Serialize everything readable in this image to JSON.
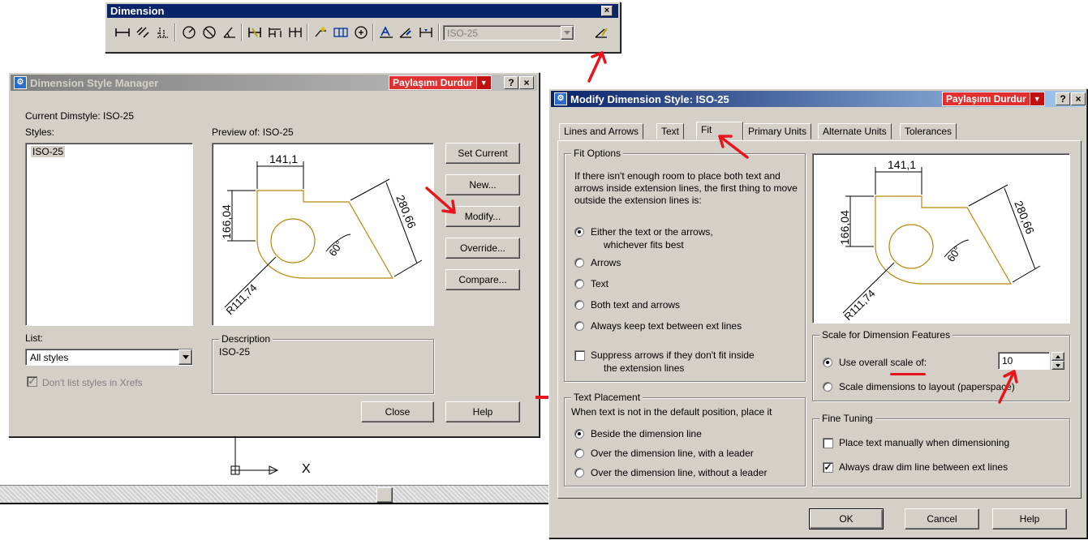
{
  "toolbar": {
    "title": "Dimension",
    "close": "×",
    "style_value": "ISO-25",
    "icons": [
      "linear-dim",
      "aligned-dim",
      "ordinate-dim",
      "radius-dim",
      "diameter-dim",
      "angular-dim",
      "quick-dim",
      "baseline-dim",
      "continue-dim",
      "leader",
      "tolerance",
      "center-mark",
      "dimedit",
      "dimtedit",
      "dim-update",
      "dim-style"
    ]
  },
  "dsm": {
    "title": "Dimension Style Manager",
    "share_label": "Paylaşımı Durdur",
    "help_cap": "?",
    "close_cap": "×",
    "current_dimstyle": "Current Dimstyle: ISO-25",
    "styles_label": "Styles:",
    "styles": [
      "ISO-25"
    ],
    "preview_label": "Preview of: ISO-25",
    "buttons": {
      "set_current": "Set Current",
      "new": "New...",
      "modify": "Modify...",
      "override": "Override...",
      "compare": "Compare...",
      "close": "Close",
      "help": "Help"
    },
    "list_label": "List:",
    "list_value": "All styles",
    "xrefs_label": "Don't list styles in Xrefs",
    "xrefs_mark": "✓",
    "description_label": "Description",
    "description_value": "ISO-25"
  },
  "preview": {
    "dim_top": "141,1",
    "dim_left": "166,04",
    "dim_diag": "280,66",
    "angle": "60°",
    "radius": "R111,74"
  },
  "ucs": {
    "x_label": "X"
  },
  "mds": {
    "title": "Modify Dimension Style: ISO-25",
    "share_label": "Paylaşımı Durdur",
    "help_cap": "?",
    "close_cap": "×",
    "tabs": [
      "Lines and Arrows",
      "Text",
      "Fit",
      "Primary Units",
      "Alternate Units",
      "Tolerances"
    ],
    "fit_options": {
      "label": "Fit Options",
      "intro": "If there isn't enough room to place both text and arrows inside extension lines, the first thing to move outside the extension lines is:",
      "opt_either_1": "Either the text or the arrows,",
      "opt_either_2": "whichever fits best",
      "opt_arrows": "Arrows",
      "opt_text": "Text",
      "opt_both": "Both text and arrows",
      "opt_always": "Always keep text between ext lines",
      "suppress_1": "Suppress arrows if they don't fit inside",
      "suppress_2": "the extension lines"
    },
    "text_placement": {
      "label": "Text Placement",
      "intro": "When text is not in the default position, place it",
      "opt_beside": "Beside the dimension line",
      "opt_leader": "Over the dimension line, with a leader",
      "opt_noleader": "Over the dimension line, without a leader"
    },
    "scale": {
      "label": "Scale for Dimension Features",
      "use_overall": "Use overall scale of:",
      "value": "10",
      "to_layout": "Scale dimensions to layout (paperspace)"
    },
    "fine_tuning": {
      "label": "Fine Tuning",
      "place_manual": "Place text manually when dimensioning",
      "always_draw": "Always draw dim line between ext lines",
      "check_mark": "✓"
    },
    "buttons": {
      "ok": "OK",
      "cancel": "Cancel",
      "help": "Help"
    }
  }
}
